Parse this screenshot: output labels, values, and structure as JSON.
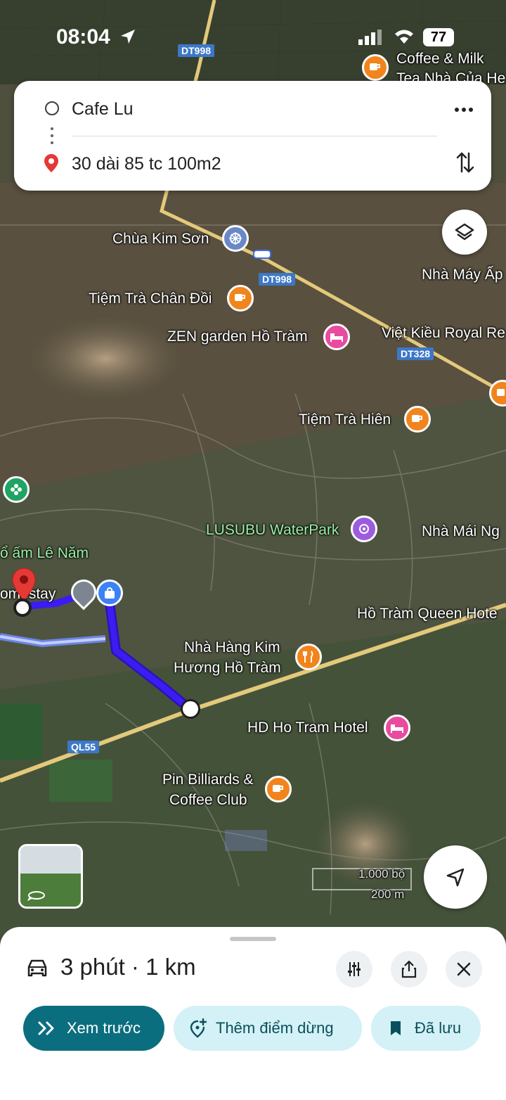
{
  "status_bar": {
    "time": "08:04",
    "battery": "77"
  },
  "directions": {
    "origin": "Cafe Lu",
    "destination": "30 dài 85 tc 100m2",
    "more_icon": "more-vert-icon",
    "swap_icon": "swap-icon"
  },
  "map": {
    "road_labels": [
      "DT998",
      "DT998",
      "DT328",
      "QL55"
    ],
    "places": {
      "coffee_milk_line1": "Coffee & Milk",
      "coffee_milk_line2": "Tea Nhà Của He",
      "chua_kim_son": "Chùa Kim Sơn",
      "nha_may": "Nhà Máy Ấp",
      "tiem_tra_chan_doi": "Tiệm Trà Chân Đồi",
      "zen_garden": "ZEN garden Hồ Tràm",
      "viet_kieu": "Việt Kiều Royal Re",
      "tiem_tra_hien": "Tiệm Trà Hiên",
      "lusubu": "LUSUBU WaterPark",
      "nha_mai": "Nhà Mái Ng",
      "to_am": "ổ ấm Lê Năm",
      "homestay": "omestay",
      "queen_hotel": "Hồ Tràm Queen Hote",
      "nha_hang_line1": "Nhà Hàng Kim",
      "nha_hang_line2": "Hương Hồ Tràm",
      "hd_hotel": "HD Ho Tram Hotel",
      "billiards_line1": "Pin Billiards &",
      "billiards_line2": "Coffee Club"
    },
    "scale_ft": "1.000 bộ",
    "scale_m": "200 m"
  },
  "bottom_sheet": {
    "eta": "3 phút · 1 km",
    "preview_label": "Xem trước",
    "add_stop_label": "Thêm điểm dừng",
    "saved_label": "Đã lưu"
  },
  "colors": {
    "route": "#3b1cf2",
    "accent_teal": "#0b6e7f",
    "pill_light": "#d3f1f6",
    "coffee_orange": "#f2841d",
    "hotel_pink": "#e84ba0",
    "pin_red": "#e53935"
  }
}
